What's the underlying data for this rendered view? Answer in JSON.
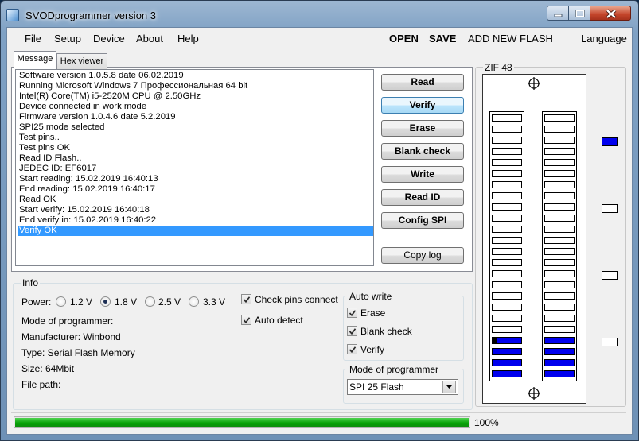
{
  "window": {
    "title": "SVODprogrammer version 3"
  },
  "menu": {
    "items": [
      "File",
      "Setup",
      "Device",
      "About",
      "Help"
    ]
  },
  "actions": {
    "open": "OPEN",
    "save": "SAVE",
    "add_flash": "ADD NEW FLASH",
    "language": "Language"
  },
  "tabs": [
    "Message",
    "Hex viewer"
  ],
  "log": [
    "Software version 1.0.5.8 date 06.02.2019",
    "Running Microsoft Windows 7 Профессиональная  64 bit",
    "Intel(R) Core(TM) i5-2520M CPU @ 2.50GHz",
    "Device connected in work mode",
    "Firmware version 1.0.4.6 date 5.2.2019",
    "SPI25 mode selected",
    "Test pins..",
    "Test pins OK",
    "Read ID Flash..",
    "JEDEC ID: EF6017",
    "Start reading: 15.02.2019 16:40:13",
    "End reading: 15.02.2019 16:40:17",
    "Read OK",
    "Start verify: 15.02.2019 16:40:18",
    "End verify in: 15.02.2019 16:40:22",
    "Verify OK"
  ],
  "log_selected_index": 15,
  "buttons": {
    "read": "Read",
    "verify": "Verify",
    "erase": "Erase",
    "blank_check": "Blank check",
    "write": "Write",
    "read_id": "Read ID",
    "config_spi": "Config SPI",
    "copy_log": "Copy log"
  },
  "info": {
    "group_label": "Info",
    "power_label": "Power:",
    "voltages": [
      "1.2 V",
      "1.8 V",
      "2.5 V",
      "3.3 V"
    ],
    "selected_voltage": 1,
    "mode": "Mode of programmer:",
    "manufacturer": "Manufacturer: Winbond",
    "type": "Type: Serial Flash Memory",
    "size": "Size: 64Mbit",
    "file_path": "File path:",
    "check_pins": "Check pins connect",
    "check_pins_checked": true,
    "auto_detect": "Auto detect",
    "auto_detect_checked": true
  },
  "auto_write": {
    "label": "Auto write",
    "erase": "Erase",
    "blank_check": "Blank check",
    "verify": "Verify",
    "erase_checked": true,
    "blank_check_checked": true,
    "verify_checked": true
  },
  "mode_select": {
    "label": "Mode of programmer",
    "value": "SPI 25 Flash"
  },
  "progress": {
    "value": 100,
    "label": "100%"
  },
  "zif": {
    "label": "ZIF 48",
    "pins_per_side": 24,
    "active_pins_bottom": 4,
    "pin1_marker": "black",
    "side_indicators": [
      true,
      false,
      false,
      false
    ]
  },
  "colors": {
    "pin_active": "#0000ee",
    "progress": "#06a006",
    "selection": "#3399ff"
  }
}
